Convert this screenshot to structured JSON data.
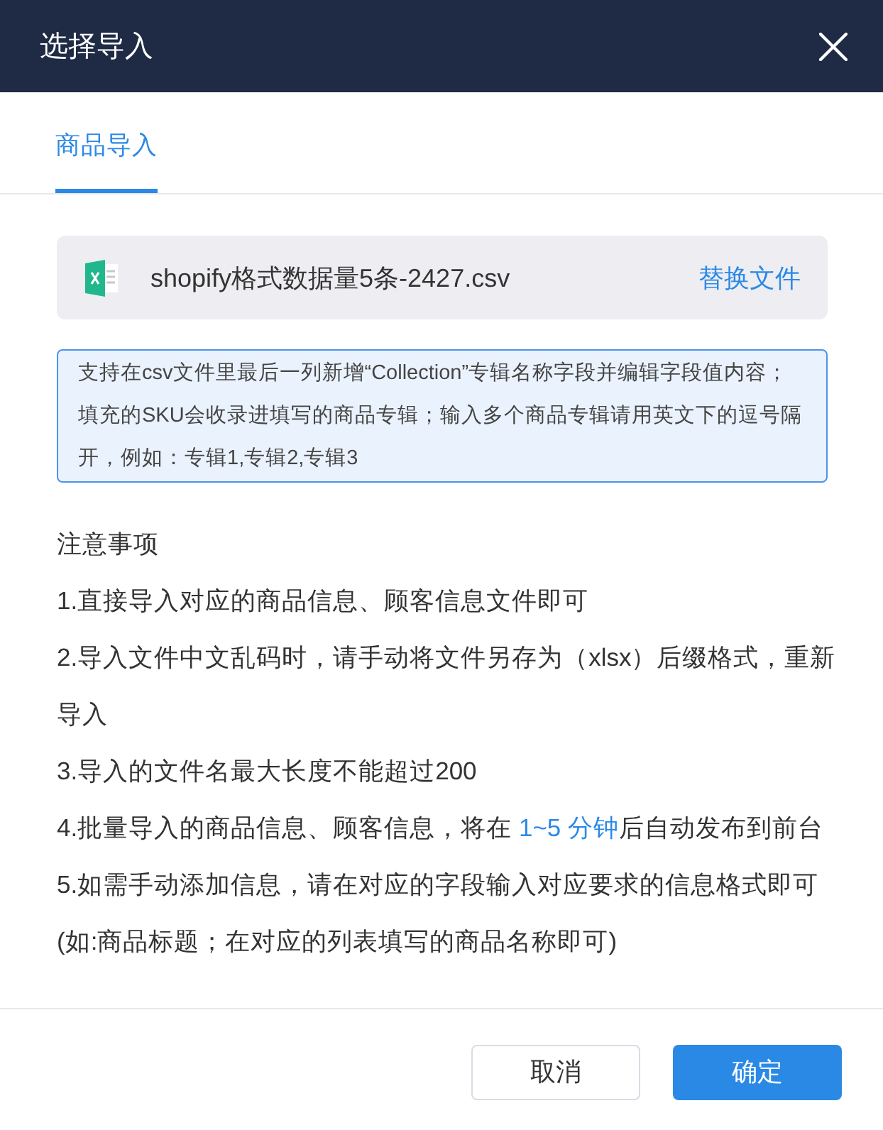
{
  "dialog": {
    "title": "选择导入"
  },
  "tabs": [
    {
      "label": "商品导入",
      "selected": true
    }
  ],
  "file": {
    "name": "shopify格式数据量5条-2427.csv",
    "action": "替换文件"
  },
  "notice": "支持在csv文件里最后一列新增“Collection”专辑名称字段并编辑字段值内容；填充的SKU会收录进填写的商品专辑；输入多个商品专辑请用英文下的逗号隔开，例如：专辑1,专辑2,专辑3",
  "notes": {
    "heading": "注意事项",
    "items": [
      {
        "parts": [
          {
            "text": "1.直接导入对应的商品信息、顾客信息文件即可",
            "highlight": false
          }
        ]
      },
      {
        "parts": [
          {
            "text": "2.导入文件中文乱码时，请手动将文件另存为（xlsx）后缀格式，重新导入",
            "highlight": false
          }
        ]
      },
      {
        "parts": [
          {
            "text": "3.导入的文件名最大长度不能超过200",
            "highlight": false
          }
        ]
      },
      {
        "parts": [
          {
            "text": "4.批量导入的商品信息、顾客信息，将在 ",
            "highlight": false
          },
          {
            "text": "1~5 分钟",
            "highlight": true
          },
          {
            "text": "后自动发布到前台",
            "highlight": false
          }
        ]
      },
      {
        "parts": [
          {
            "text": "5.如需手动添加信息，请在对应的字段输入对应要求的信息格式即可",
            "highlight": false
          }
        ]
      },
      {
        "parts": [
          {
            "text": "(如:商品标题；在对应的列表填写的商品名称即可)",
            "highlight": false
          }
        ]
      }
    ]
  },
  "buttons": [
    {
      "label": "取消",
      "kind": "secondary"
    },
    {
      "label": "确定",
      "kind": "primary"
    }
  ]
}
